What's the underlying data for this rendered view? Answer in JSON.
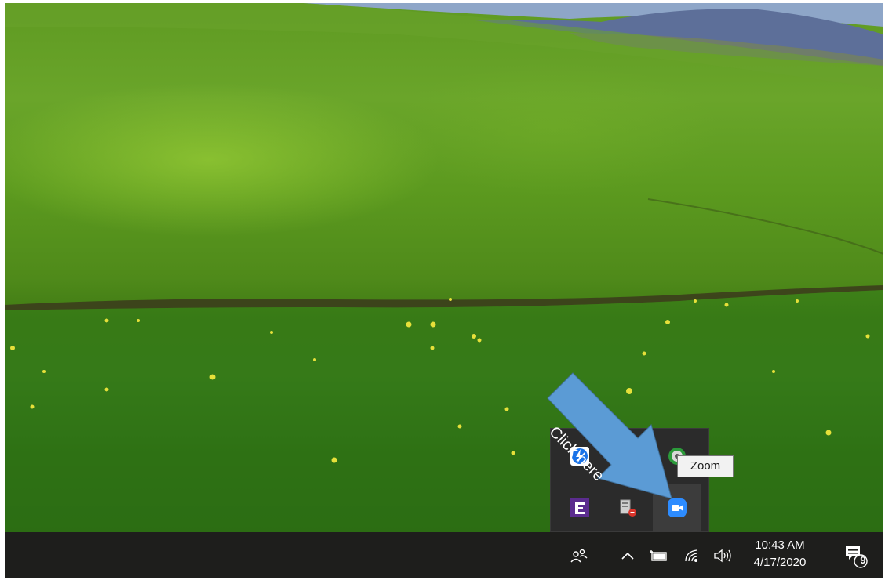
{
  "taskbar": {
    "people_icon": "people-icon",
    "show_hidden_icons": "chevron-up-icon",
    "battery_icon": "battery-icon",
    "wifi_icon": "wifi-icon",
    "volume_icon": "volume-icon",
    "clock": {
      "time": "10:43 AM",
      "date": "4/17/2020"
    },
    "action_center": {
      "icon": "action-center-icon",
      "badge": "9"
    }
  },
  "tray_flyout": {
    "icons": [
      {
        "name": "thunderbolt-icon"
      },
      {
        "name": "unknown-icon"
      },
      {
        "name": "green-app-icon"
      },
      {
        "name": "epic-games-icon"
      },
      {
        "name": "device-manager-icon"
      },
      {
        "name": "zoom-icon"
      }
    ]
  },
  "tooltip": {
    "text": "Zoom"
  },
  "callout": {
    "text": "Click here",
    "color": "#5b9bd5"
  }
}
